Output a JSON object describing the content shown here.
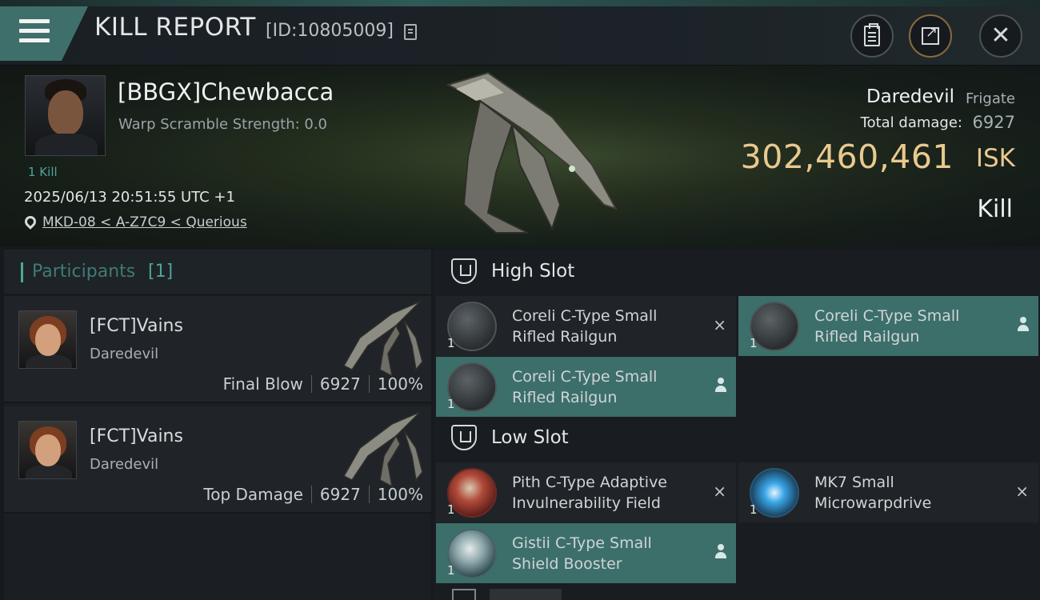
{
  "header": {
    "title": "KILL REPORT",
    "report_id": "[ID:10805009]",
    "icons": [
      "menu-icon",
      "copy-icon",
      "clipboard-icon",
      "share-icon",
      "close-icon"
    ]
  },
  "victim": {
    "name": "[BBGX]Chewbacca",
    "warp_scramble": "Warp Scramble Strength: 0.0",
    "kills": "1 Kill",
    "datetime": "2025/06/13 20:51:55 UTC +1",
    "location": "MKD-08 < A-Z7C9 < Querious",
    "ship_name": "Daredevil",
    "ship_class": "Frigate",
    "total_damage_label": "Total damage:",
    "total_damage": "6927",
    "isk_value": "302,460,461",
    "isk_unit": "ISK",
    "result": "Kill"
  },
  "participants": {
    "title": "Participants",
    "count": "[1]",
    "rows": [
      {
        "name": "[FCT]Vains",
        "ship": "Daredevil",
        "role": "Final Blow",
        "damage": "6927",
        "percent": "100%"
      },
      {
        "name": "[FCT]Vains",
        "ship": "Daredevil",
        "role": "Top Damage",
        "damage": "6927",
        "percent": "100%"
      }
    ]
  },
  "fitting": {
    "high_slot": {
      "title": "High Slot",
      "modules": [
        {
          "name_line1": "Coreli C-Type Small",
          "name_line2": "Rifled Railgun",
          "qty": "1",
          "status": "destroyed"
        },
        {
          "name_line1": "Coreli C-Type Small",
          "name_line2": "Rifled Railgun",
          "qty": "1",
          "status": "dropped"
        },
        {
          "name_line1": "Coreli C-Type Small",
          "name_line2": "Rifled Railgun",
          "qty": "1",
          "status": "dropped"
        }
      ]
    },
    "low_slot": {
      "title": "Low Slot",
      "modules": [
        {
          "name_line1": "Pith C-Type Adaptive",
          "name_line2": "Invulnerability Field",
          "qty": "1",
          "status": "destroyed"
        },
        {
          "name_line1": "MK7 Small",
          "name_line2": "Microwarpdrive",
          "qty": "1",
          "status": "destroyed"
        },
        {
          "name_line1": "Gistii C-Type Small",
          "name_line2": "Shield Booster",
          "qty": "1",
          "status": "dropped"
        }
      ]
    },
    "status_icons": {
      "destroyed": "×"
    }
  },
  "colors": {
    "accent_teal": "#3c6f69",
    "isk_gold": "#e9c98e",
    "kills_green": "#4fa39a"
  }
}
